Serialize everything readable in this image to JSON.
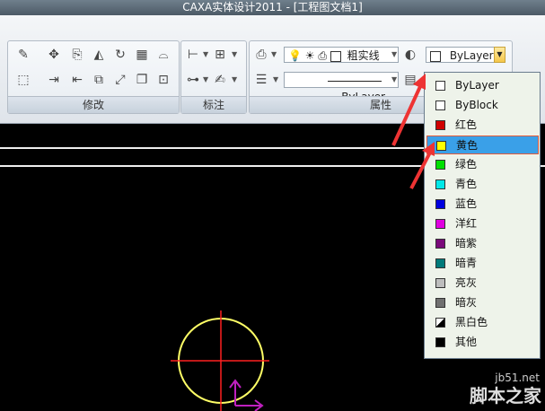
{
  "window": {
    "title": "CAXA实体设计2011 - [工程图文档1]"
  },
  "panels": {
    "modify": "修改",
    "annotate": "标注",
    "properties": "属性"
  },
  "properties_toolbar": {
    "layer_combo": "粗实线",
    "color_combo": "ByLayer",
    "linetype_combo": "ByLayer"
  },
  "color_menu": {
    "items": [
      {
        "label": "ByLayer",
        "color": "#ffffff"
      },
      {
        "label": "ByBlock",
        "color": "#ffffff"
      },
      {
        "label": "红色",
        "color": "#d00000"
      },
      {
        "label": "黄色",
        "color": "#ffff00"
      },
      {
        "label": "绿色",
        "color": "#00e000"
      },
      {
        "label": "青色",
        "color": "#00e8e8"
      },
      {
        "label": "蓝色",
        "color": "#0000e0"
      },
      {
        "label": "洋红",
        "color": "#e000e0"
      },
      {
        "label": "暗紫",
        "color": "#7a0a7a"
      },
      {
        "label": "暗青",
        "color": "#007a7a"
      },
      {
        "label": "亮灰",
        "color": "#bdbdbd"
      },
      {
        "label": "暗灰",
        "color": "#707070"
      },
      {
        "label": "黑白色",
        "color": "#000000"
      },
      {
        "label": "其他",
        "color": "#000000"
      }
    ],
    "selected_index": 3
  },
  "watermark": {
    "site": "jb51.net",
    "brand": "脚本之家"
  }
}
